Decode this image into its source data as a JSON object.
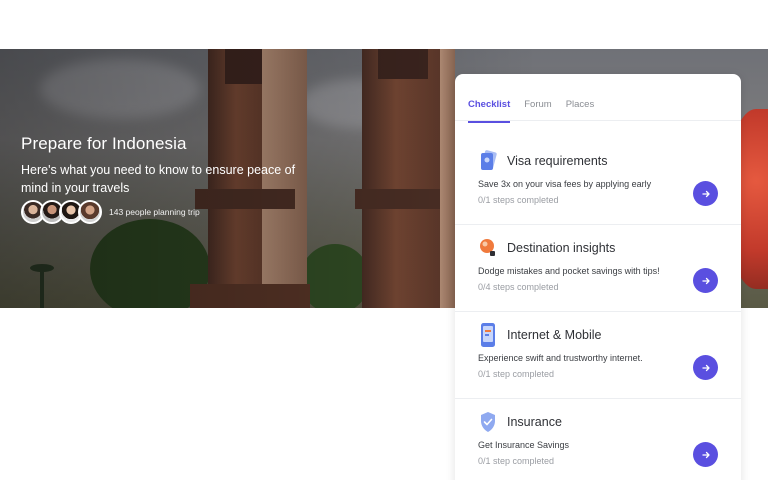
{
  "hero": {
    "title": "Prepare for Indonesia",
    "subtitle": "Here's what you need to know to ensure peace of mind in your travels",
    "planners_text": "143 people planning trip"
  },
  "card": {
    "tabs": [
      {
        "label": "Checklist",
        "active": true
      },
      {
        "label": "Forum",
        "active": false
      },
      {
        "label": "Places",
        "active": false
      }
    ],
    "items": [
      {
        "title": "Visa requirements",
        "description": "Save 3x on your visa fees by applying early",
        "steps": "0/1 steps completed",
        "icon": "passport-icon"
      },
      {
        "title": "Destination insights",
        "description": "Dodge mistakes and pocket savings with tips!",
        "steps": "0/4 steps completed",
        "icon": "lightbulb-icon"
      },
      {
        "title": "Internet & Mobile",
        "description": "Experience swift and trustworthy internet.",
        "steps": "0/1 step completed",
        "icon": "phone-icon"
      },
      {
        "title": "Insurance",
        "description": "Get Insurance Savings",
        "steps": "0/1 step completed",
        "icon": "shield-icon"
      }
    ]
  },
  "colors": {
    "accent": "#5a4fe0",
    "muted": "#9a9da3"
  }
}
